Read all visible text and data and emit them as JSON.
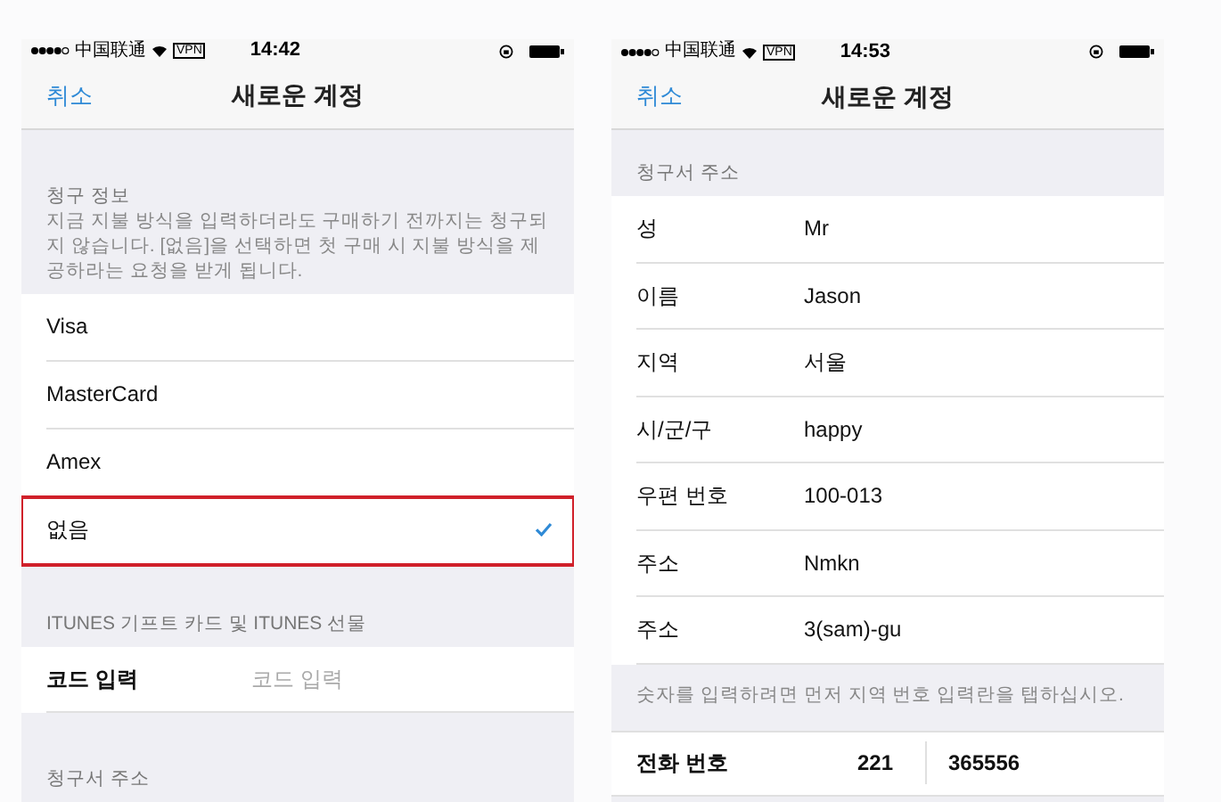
{
  "screens": [
    {
      "status_bar": {
        "carrier": "中国联通",
        "vpn": "VPN",
        "time": "14:42"
      },
      "nav": {
        "cancel": "취소",
        "title": "새로운 계정"
      },
      "rows": [
        {
          "kind": "header",
          "title": "청구 정보",
          "note": "지금 지불 방식을 입력하더라도 구매하기 전까지는 청구되지 않습니다. [없음]을 선택하면 첫 구매 시 지불 방식을 제공하라는 요청을 받게 됩니다."
        },
        {
          "kind": "option",
          "label": "Visa",
          "selected": false,
          "highlighted": false
        },
        {
          "kind": "option",
          "label": "MasterCard",
          "selected": false,
          "highlighted": false
        },
        {
          "kind": "option",
          "label": "Amex",
          "selected": false,
          "highlighted": false
        },
        {
          "kind": "option",
          "label": "없음",
          "selected": true,
          "highlighted": true
        },
        {
          "kind": "header",
          "title": "ITUNES 기프트 카드 및 ITUNES 선물"
        },
        {
          "kind": "field",
          "label": "코드 입력",
          "placeholder": "코드 입력"
        },
        {
          "kind": "header",
          "title": "청구서 주소"
        }
      ]
    },
    {
      "status_bar": {
        "carrier": "中国联通",
        "vpn": "VPN",
        "time": "14:53"
      },
      "nav": {
        "cancel": "취소",
        "title": "새로운 계정"
      },
      "rows": [
        {
          "kind": "header",
          "title": "청구서 주소"
        },
        {
          "kind": "field",
          "label": "성",
          "value": "Mr"
        },
        {
          "kind": "field",
          "label": "이름",
          "value": "Jason"
        },
        {
          "kind": "field",
          "label": "지역",
          "value": "서울"
        },
        {
          "kind": "field",
          "label": "시/군/구",
          "value": "happy"
        },
        {
          "kind": "field",
          "label": "우편 번호",
          "value": "100-013"
        },
        {
          "kind": "field",
          "label": "주소",
          "value": "Nmkn"
        },
        {
          "kind": "field",
          "label": "주소",
          "value": "3(sam)-gu"
        },
        {
          "kind": "note",
          "text": "숫자를 입력하려면 먼저 지역 번호 입력란을 탭하십시오."
        },
        {
          "kind": "phone",
          "label": "전화 번호",
          "area_code": "221",
          "number": "365556"
        }
      ]
    }
  ]
}
